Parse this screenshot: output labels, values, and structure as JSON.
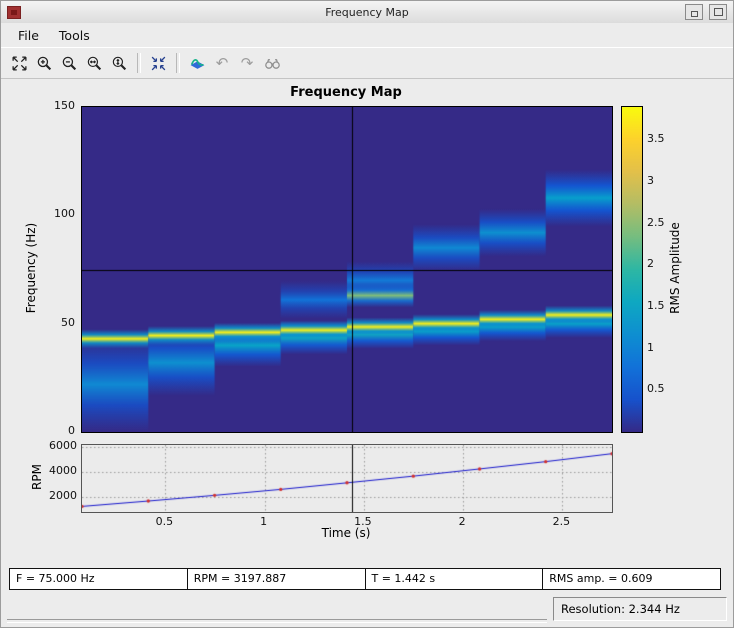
{
  "window": {
    "title": "Frequency Map"
  },
  "menu": {
    "items": [
      "File",
      "Tools"
    ]
  },
  "toolbar": {
    "icons": [
      "expand-icon",
      "zoom-in-icon",
      "zoom-out-icon",
      "zoom-x-icon",
      "zoom-y-icon",
      "reset-view-icon",
      "surface-icon",
      "undo-icon",
      "redo-icon",
      "binoculars-icon"
    ]
  },
  "readouts": {
    "frequency": "F = 75.000 Hz",
    "rpm": "RPM = 3197.887",
    "time": "T = 1.442 s",
    "rms": "RMS amp. = 0.609"
  },
  "statusbar": {
    "resolution": "Resolution: 2.344 Hz"
  },
  "chart_data": [
    {
      "type": "heatmap",
      "title": "Frequency Map",
      "ylabel": "Frequency (Hz)",
      "colorbar_label": "RMS Amplitude",
      "colormap": "parula",
      "xlim": [
        0.08,
        2.75
      ],
      "ylim": [
        0,
        150
      ],
      "yticks": [
        0,
        50,
        100,
        150
      ],
      "vmax": 3.9,
      "colorbar_ticks": [
        0.5,
        1,
        1.5,
        2,
        2.5,
        3,
        3.5
      ],
      "crosshair": {
        "time_s": 1.442,
        "freq_hz": 75
      },
      "bands_format": "[center_hz, half_width_hz, rms_amplitude]",
      "segments": [
        {
          "t0": 0.08,
          "t1": 0.414,
          "bands": [
            [
              22,
              10,
              1.1
            ],
            [
              43,
              2,
              3.8
            ]
          ]
        },
        {
          "t0": 0.414,
          "t1": 0.748,
          "bands": [
            [
              32,
              7,
              1.2
            ],
            [
              44.5,
              2,
              3.8
            ]
          ]
        },
        {
          "t0": 0.748,
          "t1": 1.081,
          "bands": [
            [
              40,
              4.5,
              1.5
            ],
            [
              46,
              2,
              3.8
            ]
          ]
        },
        {
          "t0": 1.081,
          "t1": 1.415,
          "bands": [
            [
              61,
              4,
              0.8
            ],
            [
              43.5,
              3.5,
              1.6
            ],
            [
              47,
              2,
              3.8
            ]
          ]
        },
        {
          "t0": 1.415,
          "t1": 1.749,
          "bands": [
            [
              70,
              4,
              0.9
            ],
            [
              45,
              3,
              1.6
            ],
            [
              63,
              2.5,
              2.4
            ],
            [
              48.5,
              2,
              3.8
            ]
          ]
        },
        {
          "t0": 1.749,
          "t1": 2.083,
          "bands": [
            [
              85,
              5,
              1.1
            ],
            [
              46.5,
              3,
              1.5
            ],
            [
              50,
              2,
              3.8
            ]
          ]
        },
        {
          "t0": 2.083,
          "t1": 2.416,
          "bands": [
            [
              92,
              5,
              1.2
            ],
            [
              48.5,
              3,
              1.5
            ],
            [
              52,
              2,
              3.8
            ]
          ]
        },
        {
          "t0": 2.416,
          "t1": 2.75,
          "bands": [
            [
              108,
              6,
              1.4
            ],
            [
              50,
              3,
              1.5
            ],
            [
              54,
              2,
              3.8
            ]
          ]
        }
      ]
    },
    {
      "type": "line",
      "ylabel": "RPM",
      "xlabel": "Time (s)",
      "xlim": [
        0.08,
        2.75
      ],
      "ylim": [
        800,
        6200
      ],
      "yticks": [
        2000,
        4000,
        6000
      ],
      "xticks": [
        0.5,
        1,
        1.5,
        2,
        2.5
      ],
      "grid": true,
      "crosshair": {
        "time_s": 1.442
      },
      "series": [
        {
          "name": "rpm-profile",
          "color": "#1414cc",
          "marker_color": "#d03030",
          "points": [
            [
              0.08,
              1250
            ],
            [
              0.414,
              1683
            ],
            [
              0.748,
              2140
            ],
            [
              1.081,
              2621
            ],
            [
              1.415,
              3152
            ],
            [
              1.749,
              3689
            ],
            [
              2.083,
              4270
            ],
            [
              2.416,
              4860
            ],
            [
              2.75,
              5500
            ]
          ]
        }
      ]
    }
  ]
}
